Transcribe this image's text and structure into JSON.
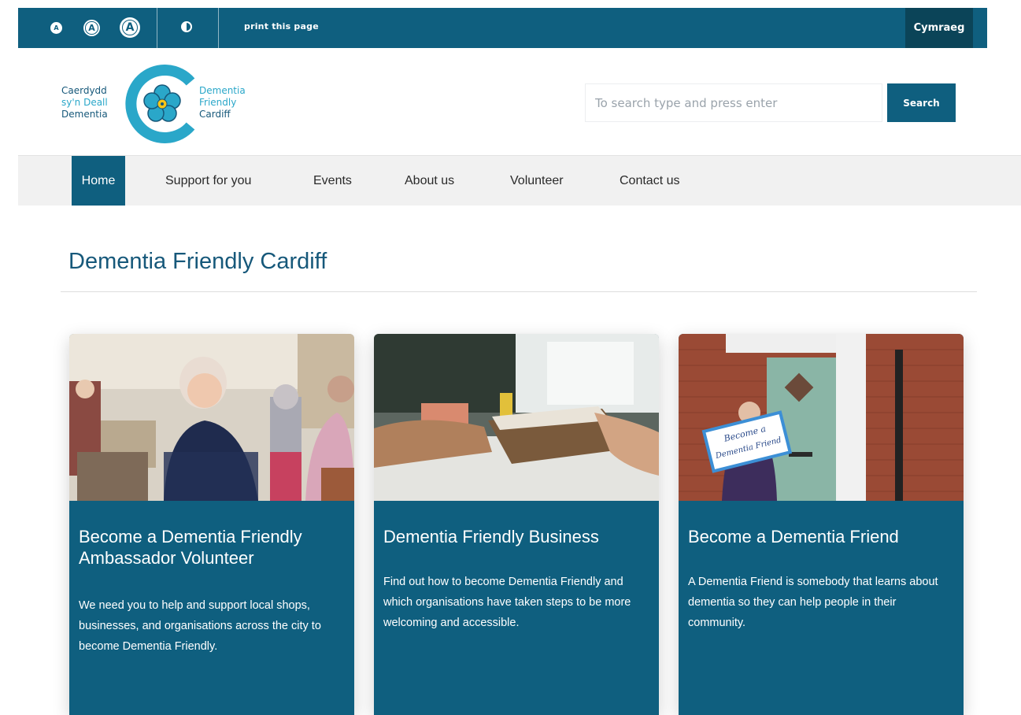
{
  "topbar": {
    "text_size_small": "A",
    "text_size_medium": "A",
    "text_size_large": "A",
    "print_label": "print this page",
    "language_label": "Cymraeg"
  },
  "logo": {
    "welsh_line1": "Caerdydd",
    "welsh_line2": "sy'n Deall",
    "welsh_line3": "Dementia",
    "english_line1": "Dementia",
    "english_line2": "Friendly",
    "english_line3": "Cardiff"
  },
  "search": {
    "placeholder": "To search type and press enter",
    "button_label": "Search"
  },
  "nav": {
    "items": [
      {
        "label": "Home"
      },
      {
        "label": "Support for you"
      },
      {
        "label": "Events"
      },
      {
        "label": "About us"
      },
      {
        "label": "Volunteer"
      },
      {
        "label": "Contact us"
      }
    ]
  },
  "page": {
    "title": "Dementia Friendly Cardiff"
  },
  "cards": [
    {
      "title": "Become a Dementia Friendly Ambassador Volunteer",
      "text": "We need you to help and support local shops, businesses, and organisations across the city to become Dementia Friendly."
    },
    {
      "title": "Dementia Friendly Business",
      "text": "Find out how to become Dementia Friendly and which organisations have taken steps to be more welcoming and accessible."
    },
    {
      "title": "Become a Dementia Friend",
      "text": "A Dementia Friend is somebody that learns about dementia so they can help people in their community.",
      "photo_sign_text": "Become a Dementia Friend"
    }
  ],
  "colors": {
    "brand_teal": "#0f5f7f",
    "brand_dark": "#0b4458",
    "logo_light_blue": "#2aa7c9",
    "nav_background": "#f1f1f1"
  },
  "icons": {
    "text_size": "text-size-icon",
    "contrast": "contrast-icon",
    "logo_flower": "forget-me-not-flower-icon"
  }
}
